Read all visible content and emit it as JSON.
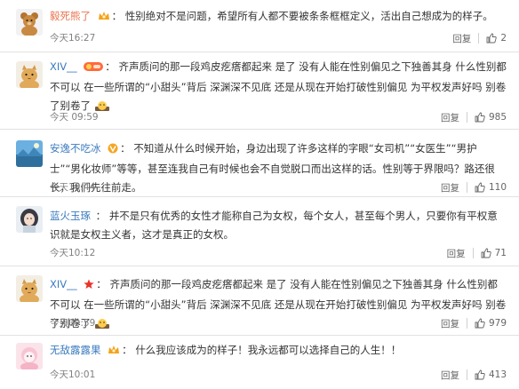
{
  "reply_label": "回复",
  "comments": [
    {
      "username": "毅死熊了",
      "text": "性别绝对不是问题，希望所有人都不要被条条框框定义，活出自己想成为的样子。",
      "time": "今天16:27",
      "likes": "2",
      "avatar": "teddy-bear-avatar"
    },
    {
      "username": "XIV__",
      "text": "齐声质问的那一段鸡皮疙瘩都起来 是了 没有人能在性别偏见之下独善其身 什么性别都不可以 在一些所谓的“小甜头”背后 深渊深不见底 还是从现在开始打破性别偏见 为平权发声好吗 别卷了别卷了",
      "time": "今天 09:59",
      "likes": "985",
      "avatar": "cat-avatar"
    },
    {
      "username": "安逸不吃冰",
      "text": "不知道从什么时候开始，身边出现了许多这样的字眼“女司机”“女医生”“男护士”“男化妆师”等等，甚至连我自己有时候也会不自觉脱口而出这样的话。性别等于界限吗？路还很长，我们先往前走。",
      "time": "今天10:44",
      "likes": "110",
      "avatar": "landscape-avatar"
    },
    {
      "username": "蓝火玉琢",
      "text": "并不是只有优秀的女性才能称自己为女权，每个女人，甚至每个男人，只要你有平权意识就是女权主义者，这才是真正的女权。",
      "time": "今天10:12",
      "likes": "71",
      "avatar": "girl-avatar"
    },
    {
      "username": "XIV__",
      "text": "齐声质问的那一段鸡皮疙瘩都起来 是了 没有人能在性别偏见之下独善其身 什么性别都不可以 在一些所谓的“小甜头”背后 深渊深不见底 还是从现在开始打破性别偏见 为平权发声好吗 别卷了别卷了",
      "time": "今天09:59",
      "likes": "979",
      "avatar": "cat-avatar"
    },
    {
      "username": "无敌露露果",
      "text": "什么我应该成为的样子！我永远都可以选择自己的人生！！",
      "time": "今天10:01",
      "likes": "413",
      "avatar": "pink-avatar"
    }
  ],
  "colors": {
    "username": "#eb7350",
    "username_blue": "#3b7bbf",
    "meta": "#808080",
    "divider": "#e2e2e2"
  }
}
